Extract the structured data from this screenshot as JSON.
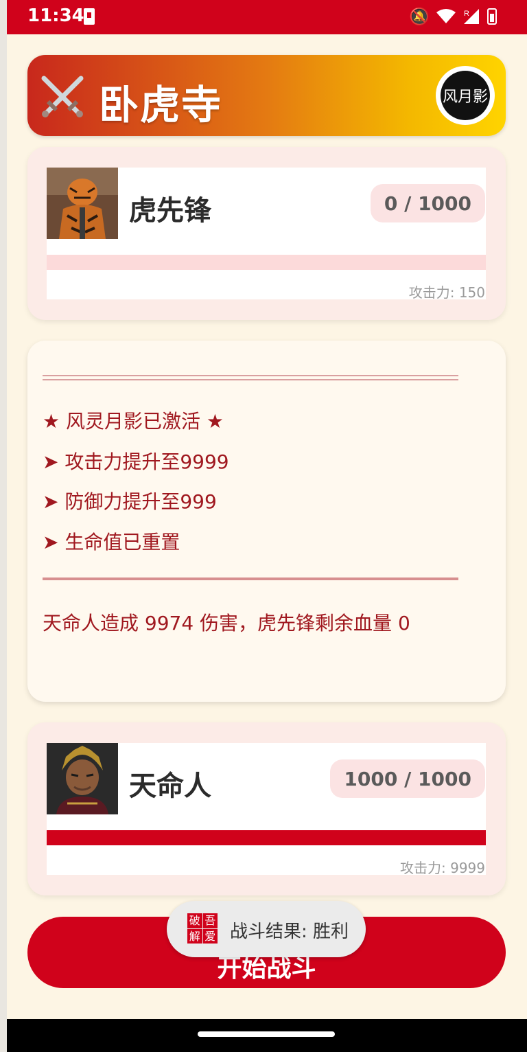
{
  "status_bar": {
    "time": "11:34",
    "icons": [
      "sim-card-icon",
      "mute-icon",
      "wifi-icon",
      "signal-roaming-icon",
      "battery-charging-icon"
    ],
    "roaming": "R"
  },
  "header": {
    "emoji": "⚔️",
    "title": "卧虎寺",
    "logo_text": "风月影"
  },
  "enemy": {
    "name": "虎先锋",
    "hp_text": "0 / 1000",
    "hp_fraction": 0,
    "attack_text": "攻击力: 150"
  },
  "battle_log": {
    "divider_top": "═══════════════════════════",
    "lines": [
      "★ 风灵月影已激活 ★",
      "➤ 攻击力提升至9999",
      "➤ 防御力提升至999",
      "➤ 生命值已重置"
    ],
    "divider_bottom": "───────────────────────────",
    "result_line": "天命人造成 9974 伤害，虎先锋剩余血量 0"
  },
  "player": {
    "name": "天命人",
    "hp_text": "1000 / 1000",
    "hp_fraction": 1,
    "attack_text": "攻击力: 9999"
  },
  "action": {
    "button_label": "开始战斗"
  },
  "toast": {
    "icon_chars": [
      "破",
      "吾",
      "解",
      "爱"
    ],
    "message": "战斗结果: 胜利"
  },
  "colors": {
    "primary_red": "#d0021b",
    "background": "#fdf5e4",
    "log_text": "#a0181f"
  }
}
